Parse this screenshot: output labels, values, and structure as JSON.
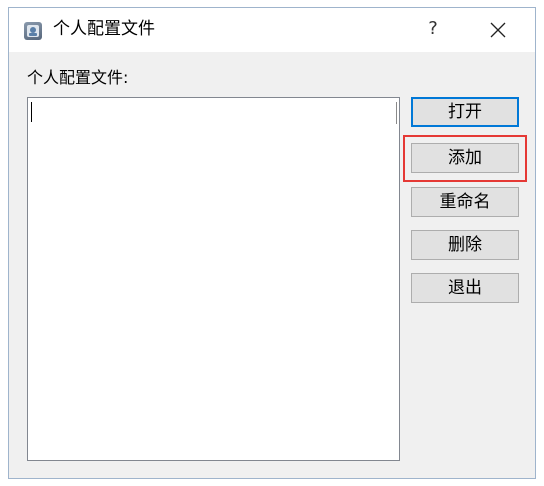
{
  "window": {
    "title": "个人配置文件",
    "help_label": "?"
  },
  "main": {
    "list_label": "个人配置文件:",
    "profiles": []
  },
  "buttons": {
    "open": "打开",
    "add": "添加",
    "rename": "重命名",
    "delete": "删除",
    "exit": "退出"
  },
  "icons": {
    "app": "profile-app-icon",
    "close": "close-icon"
  },
  "colors": {
    "default_button_border": "#0078d7",
    "highlight_border": "#e53935"
  }
}
